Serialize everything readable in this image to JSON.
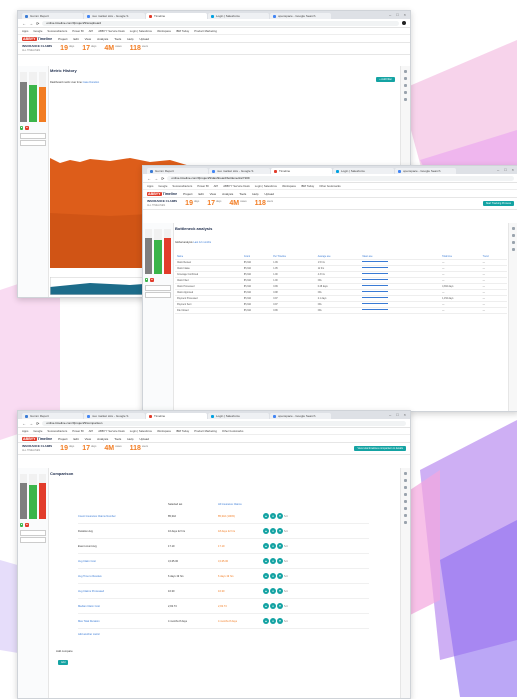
{
  "tabs": [
    "Gumm Report",
    "nuo market size - Google S",
    "Timeline",
    "Login | Salesforce",
    "openspace - Google Search"
  ],
  "url_w1": "online.timeline.com/f/project/9/snapboard",
  "url_w2": "online.timeline.com/f/project/9/dashboard/bottlenecks/7209",
  "url_w3": "online.timeline.com/f/project/9/comparison",
  "bookmarks": [
    "Apps",
    "Google",
    "SuccessFactors",
    "Power BI",
    "API",
    "ABBYY Service Desk",
    "Login | Salesforce",
    "Workspace",
    "IBM Today",
    "Product Marketing",
    "Other bookmarks"
  ],
  "app": {
    "brand_a": "ABBYY",
    "brand_b": "Timeline",
    "menu": [
      "Project",
      "Edit",
      "View",
      "Analysis",
      "Tools",
      "Help",
      "Upload"
    ],
    "project_name": "INSURANCE CLAIMS",
    "project_sub": "ALL TIMELINES"
  },
  "stats": [
    {
      "value": "19",
      "unit": "days"
    },
    {
      "value": "17",
      "unit": "days"
    },
    {
      "value": "4M",
      "unit": "cases"
    },
    {
      "value": "118",
      "unit": "users"
    }
  ],
  "w1": {
    "title": "Metric History",
    "filter_label": "Dashboard metric over time",
    "filter_value": "Case Duration",
    "new_btn": "+ Add Filter"
  },
  "w2": {
    "title": "Bottleneck analysis",
    "alert_btn": "Start Tracking Process",
    "group_label": "Global analysis",
    "group_value": "Last 12 months",
    "headers": [
      "Name",
      "Count",
      "Per Timeline",
      "Average use",
      "Mean use",
      "Total time",
      "Trend"
    ],
    "rows": [
      [
        "Claim Review",
        "85,342",
        "1.09",
        "1.5 hrs",
        "",
        "—",
        "—"
      ],
      [
        "Claim Intake",
        "85,342",
        "1.05",
        "12 hrs",
        "",
        "—",
        "—"
      ],
      [
        "Coverage Confirmed",
        "85,342",
        "1.00",
        "4.3 hrs",
        "",
        "—",
        "—"
      ],
      [
        "Claim Filed",
        "85,342",
        "1.00",
        "N/A",
        "",
        "—",
        "—"
      ],
      [
        "Claim Processed",
        "85,342",
        "0.99",
        "0.28 days",
        "",
        "4,362 days",
        "—"
      ],
      [
        "Claim Approved",
        "85,342",
        "0.98",
        "N/A",
        "",
        "—",
        "—"
      ],
      [
        "Payment Processed",
        "85,342",
        "0.97",
        "2.1 days",
        "",
        "1,152 days",
        "—"
      ],
      [
        "Payment Sent",
        "85,342",
        "0.97",
        "N/A",
        "",
        "—",
        "—"
      ],
      [
        "File Closed",
        "85,342",
        "0.96",
        "N/A",
        "",
        "—",
        "—"
      ]
    ]
  },
  "w3": {
    "title": "Comparison",
    "alert_btn": "View total timelines comparison in details",
    "col_a": "Selected set",
    "col_b": "All Insurance Claims",
    "rows": [
      {
        "label": "Count Insurance Claims Number",
        "a": "85,342",
        "b": "85,342 (100%)"
      },
      {
        "label": "Duration Avg",
        "a": "16 days 22 hrs",
        "b": "18 days 22 hrs"
      },
      {
        "label": "Event count Avg",
        "a": "17.19",
        "b": "17.19"
      },
      {
        "label": "Avg Claim Cost",
        "a": "3,135.00",
        "b": "3,135.00"
      },
      {
        "label": "Avg Time to Resolve",
        "a": "6 days 19 hrs",
        "b": "6 days 19 hrs"
      },
      {
        "label": "Avg Claims Processed",
        "a": "16.30",
        "b": "16.30"
      },
      {
        "label": "Median Claim Cost",
        "a": "2,93.73",
        "b": "2,93.73"
      },
      {
        "label": "Max Total Duration",
        "a": "4 months 8 days",
        "b": "4 months 8 days"
      }
    ],
    "add_metric": "Add another metric",
    "add_compare": "Add compare",
    "add_btn": "Add"
  },
  "colors": {
    "accent": "#f27c22",
    "teal": "#14a3a3",
    "navy": "#1b2a4a",
    "red": "#e23c2b",
    "green": "#3bb54a"
  }
}
